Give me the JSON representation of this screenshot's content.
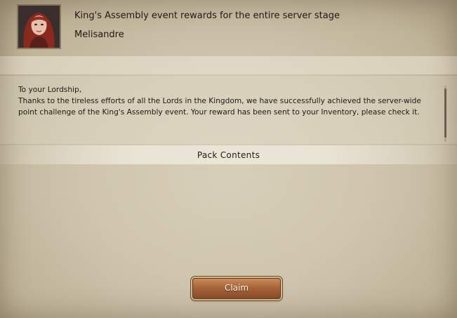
{
  "mail": {
    "subject": "King's Assembly event rewards for the entire server stage",
    "sender": "Melisandre",
    "greeting": "To your Lordship,",
    "body_line1": "Thanks to the tireless efforts of all the Lords in the Kingdom, we have successfully achieved the server-wide",
    "body_line2": "point challenge of the King's Assembly event. Your reward has been sent to your Inventory, please check it."
  },
  "pack": {
    "title": "Pack Contents"
  },
  "actions": {
    "claim_label": "Claim"
  },
  "colors": {
    "parchment": "#cfc5ae",
    "button": "#a9653a",
    "text": "#1e1a14"
  }
}
